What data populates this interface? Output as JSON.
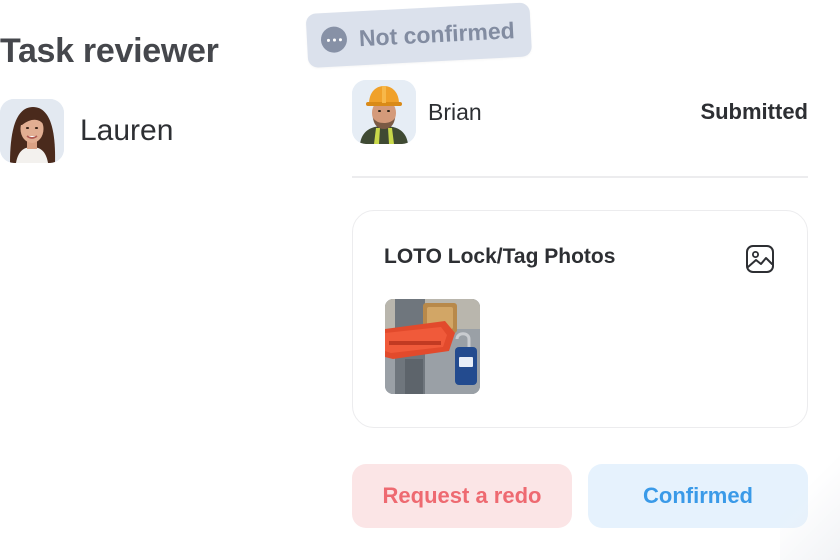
{
  "reviewer": {
    "title": "Task reviewer",
    "name": "Lauren"
  },
  "status_chip": {
    "label": "Not confirmed",
    "icon": "more-dots-icon"
  },
  "submission": {
    "submitter_name": "Brian",
    "status": "Submitted"
  },
  "photo_card": {
    "title": "LOTO Lock/Tag Photos",
    "icon": "image-icon"
  },
  "actions": {
    "redo_label": "Request a redo",
    "confirm_label": "Confirmed"
  },
  "colors": {
    "chip_bg": "#dbe1ec",
    "redo_bg": "#fbe5e6",
    "redo_text": "#ee6a71",
    "confirm_bg": "#e6f2fd",
    "confirm_text": "#3a9ae8"
  }
}
